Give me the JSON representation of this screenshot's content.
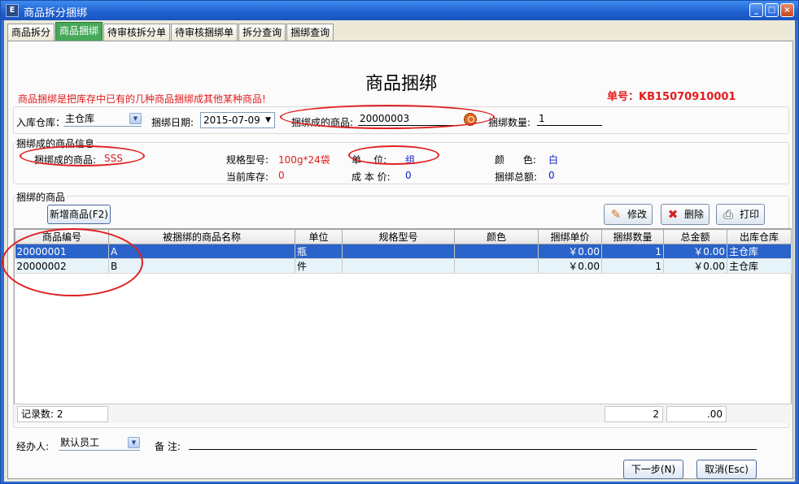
{
  "window": {
    "title": "商品拆分捆绑",
    "icon_text": "E"
  },
  "tabs": [
    {
      "label": "商品拆分"
    },
    {
      "label": "商品捆绑"
    },
    {
      "label": "待审核拆分单"
    },
    {
      "label": "待审核捆绑单"
    },
    {
      "label": "拆分查询"
    },
    {
      "label": "捆绑查询"
    }
  ],
  "heading": "商品捆绑",
  "note": "商品捆绑是把库存中已有的几种商品捆绑成其他某种商品!",
  "order_no": "单号：KB15070910001",
  "form": {
    "warehouse_label": "入库仓库：",
    "warehouse_value": "主仓库",
    "date_label": "捆绑日期:",
    "date_value": "2015-07-09",
    "product_label": "捆绑成的商品:",
    "product_value": "20000003",
    "qty_label": "捆绑数量:",
    "qty_value": "1"
  },
  "info": {
    "legend": "捆绑成的商品信息",
    "name_label": "捆绑成的商品:",
    "name_value": "SSS",
    "spec_label": "规格型号:",
    "spec_value": "100g*24袋",
    "unit_label": "单    位:",
    "unit_value": "组",
    "color_label": "颜      色:",
    "color_value": "白",
    "stock_label": "当前库存:",
    "stock_value": "0",
    "cost_label": "成 本 价:",
    "cost_value": "0",
    "total_label": "捆绑总额:",
    "total_value": "0"
  },
  "items": {
    "legend": "捆绑的商品",
    "add_button": "新增商品(F2)",
    "edit_button": "修改",
    "delete_button": "删除",
    "print_button": "打印",
    "columns": [
      "商品编号",
      "被捆绑的商品名称",
      "单位",
      "规格型号",
      "颜色",
      "捆绑单价",
      "捆绑数量",
      "总金额",
      "出库仓库"
    ],
    "rows": [
      [
        "20000001",
        "A",
        "瓶",
        "",
        "",
        "￥0.00",
        "1",
        "￥0.00",
        "主仓库"
      ],
      [
        "20000002",
        "B",
        "件",
        "",
        "",
        "￥0.00",
        "1",
        "￥0.00",
        "主仓库"
      ]
    ],
    "record_count": "记录数: 2",
    "sum_qty": "2",
    "sum_amount": ".00"
  },
  "bottom": {
    "handler_label": "经办人:",
    "handler_value": "默认员工",
    "remark_label": "备 注:",
    "remark_value": "",
    "next_button": "下一步(N)",
    "cancel_button": "取消(Esc)"
  },
  "colors": {
    "accent_red": "#e31c1c",
    "value_blue": "#1020c8",
    "selected_row": "#2a63c9",
    "active_tab": "#46a858"
  }
}
